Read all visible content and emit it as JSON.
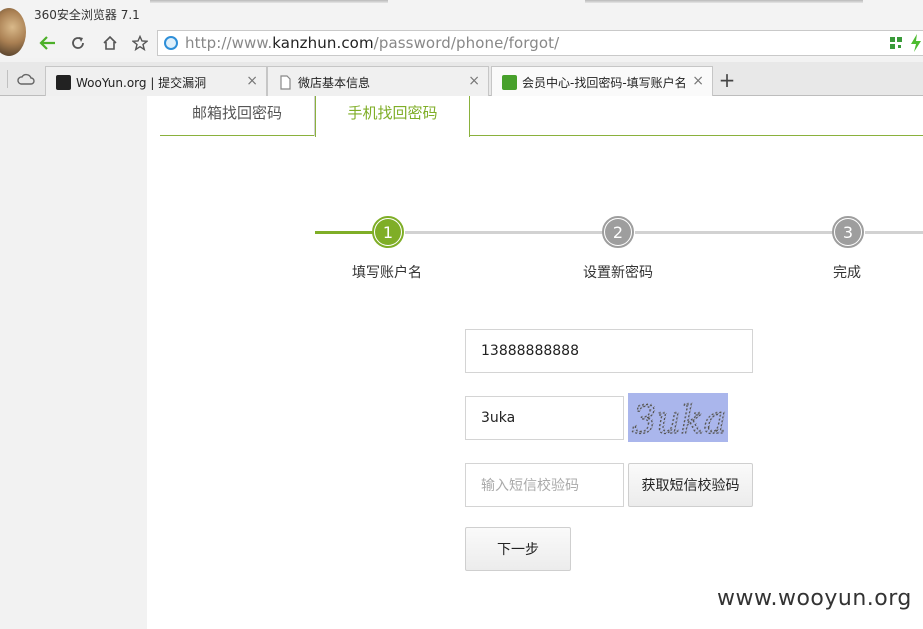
{
  "window": {
    "app_title": "360安全浏览器 7.1"
  },
  "address_bar": {
    "url_prefix": "http://www.",
    "url_domain": "kanzhun.com",
    "url_path": "/password/phone/forgot/"
  },
  "tabs": [
    {
      "label": "WooYun.org | 提交漏洞",
      "close": "×"
    },
    {
      "label": "微店基本信息",
      "close": "×"
    },
    {
      "label": "会员中心-找回密码-填写账户名",
      "close": "×"
    }
  ],
  "new_tab": "+",
  "page": {
    "recovery_tabs": [
      {
        "label": "邮箱找回密码"
      },
      {
        "label": "手机找回密码"
      }
    ],
    "steps": [
      {
        "number": "1",
        "label": "填写账户名"
      },
      {
        "number": "2",
        "label": "设置新密码"
      },
      {
        "number": "3",
        "label": "完成"
      }
    ],
    "form": {
      "phone_value": "13888888888",
      "captcha_value": "3uka",
      "captcha_image_text": "3uka",
      "sms_placeholder": "输入短信校验码",
      "sms_button": "获取短信校验码",
      "next_button": "下一步"
    }
  },
  "watermark": "www.wooyun.org",
  "colors": {
    "accent": "#7fae27",
    "step_inactive": "#9e9e9e",
    "captcha_bg": "#aab6ec"
  }
}
